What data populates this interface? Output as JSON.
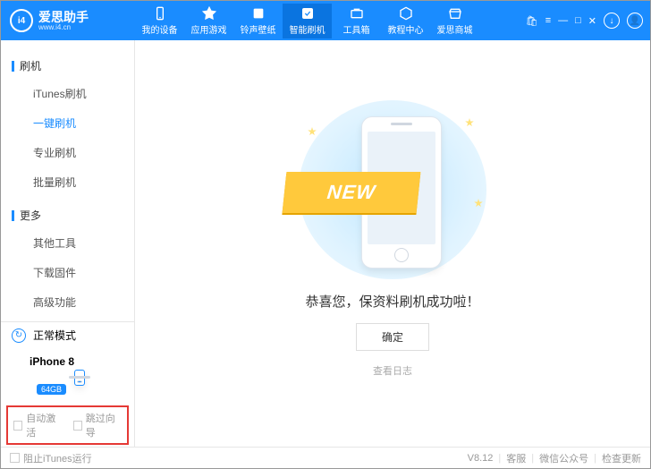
{
  "brand": {
    "name": "爱思助手",
    "sub": "www.i4.cn",
    "logo_text": "i4"
  },
  "topnav": [
    {
      "label": "我的设备"
    },
    {
      "label": "应用游戏"
    },
    {
      "label": "铃声壁纸"
    },
    {
      "label": "智能刷机",
      "active": true
    },
    {
      "label": "工具箱"
    },
    {
      "label": "教程中心"
    },
    {
      "label": "爱思商城"
    }
  ],
  "sidebar": {
    "groups": [
      {
        "title": "刷机",
        "items": [
          {
            "label": "iTunes刷机"
          },
          {
            "label": "一键刷机",
            "active": true
          },
          {
            "label": "专业刷机"
          },
          {
            "label": "批量刷机"
          }
        ]
      },
      {
        "title": "更多",
        "items": [
          {
            "label": "其他工具"
          },
          {
            "label": "下载固件"
          },
          {
            "label": "高级功能"
          }
        ]
      }
    ],
    "mode_label": "正常模式",
    "device_name": "iPhone 8",
    "device_badge": "64GB",
    "auto_activate": "自动激活",
    "skip_guide": "跳过向导"
  },
  "main": {
    "ribbon": "NEW",
    "message": "恭喜您，保资料刷机成功啦！",
    "ok": "确定",
    "view_log": "查看日志"
  },
  "footer": {
    "block_itunes": "阻止iTunes运行",
    "version": "V8.12",
    "support": "客服",
    "wechat": "微信公众号",
    "update": "检查更新"
  }
}
